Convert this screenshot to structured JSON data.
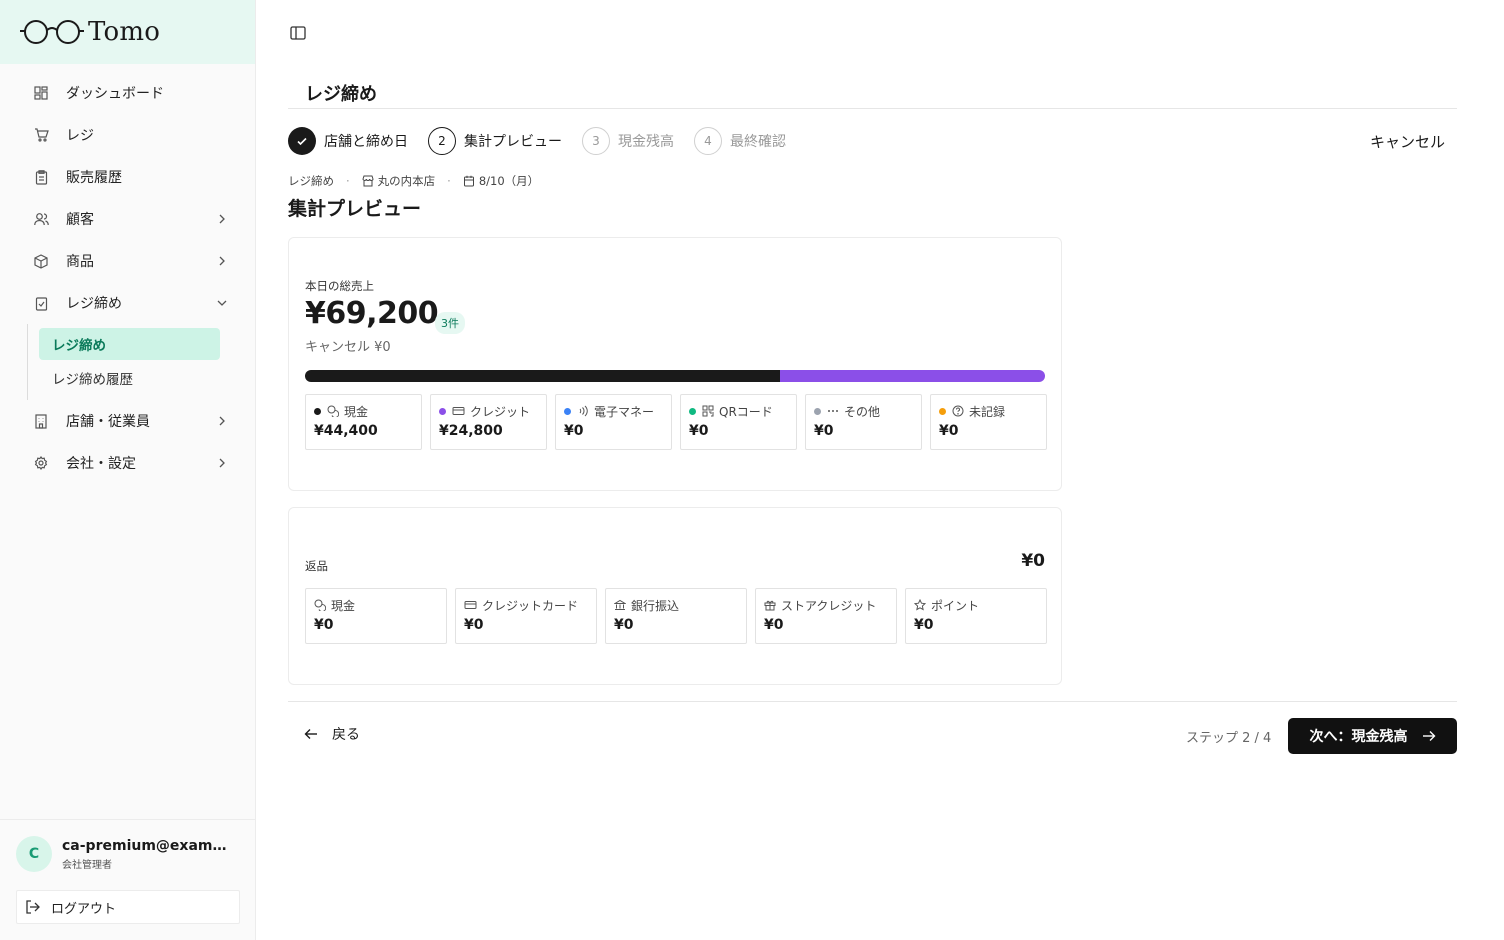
{
  "app": {
    "brand": "Tomo"
  },
  "sidebar": {
    "items": [
      {
        "label": "ダッシュボード",
        "icon": "dashboard-icon"
      },
      {
        "label": "レジ",
        "icon": "cart-icon"
      },
      {
        "label": "販売履歴",
        "icon": "receipt-icon"
      },
      {
        "label": "顧客",
        "icon": "users-icon"
      },
      {
        "label": "商品",
        "icon": "box-icon"
      },
      {
        "label": "レジ締め",
        "icon": "clipboard-check-icon"
      },
      {
        "label": "店舗・従業員",
        "icon": "building-icon"
      },
      {
        "label": "会社・設定",
        "icon": "gear-icon"
      }
    ],
    "sub_items": [
      {
        "label": "レジ締め",
        "active": true
      },
      {
        "label": "レジ締め履歴",
        "active": false
      }
    ]
  },
  "user": {
    "initial": "C",
    "email": "ca-premium@example.com",
    "role": "会社管理者",
    "logout_label": "ログアウト"
  },
  "header": {
    "title": "レジ締め"
  },
  "stepper": {
    "steps": [
      {
        "number": "1",
        "label": "店舗と締め日",
        "state": "done"
      },
      {
        "number": "2",
        "label": "集計プレビュー",
        "state": "current"
      },
      {
        "number": "3",
        "label": "現金残高",
        "state": "todo"
      },
      {
        "number": "4",
        "label": "最終確認",
        "state": "todo"
      }
    ],
    "cancel_label": "キャンセル"
  },
  "breadcrumb": {
    "root": "レジ締め",
    "store": "丸の内本店",
    "date": "8/10（月）"
  },
  "section_title": "集計プレビュー",
  "sales": {
    "label": "本日の総売上",
    "total": "¥69,200",
    "count": "3件",
    "cancel": "キャンセル ¥0",
    "payment_share": [
      {
        "method": "現金",
        "value": 44400,
        "color": "#1a1a1a"
      },
      {
        "method": "クレジット",
        "value": 24800,
        "color": "#8b4fe8"
      }
    ],
    "methods": [
      {
        "label": "現金",
        "value": "¥44,400",
        "dot": "#1a1a1a",
        "icon": "cash-icon"
      },
      {
        "label": "クレジット",
        "value": "¥24,800",
        "dot": "#8b4fe8",
        "icon": "credit-card-icon"
      },
      {
        "label": "電子マネー",
        "value": "¥0",
        "dot": "#3b82f6",
        "icon": "contactless-icon"
      },
      {
        "label": "QRコード",
        "value": "¥0",
        "dot": "#10b981",
        "icon": "qr-code-icon"
      },
      {
        "label": "その他",
        "value": "¥0",
        "dot": "#9ca3af",
        "icon": "more-icon"
      },
      {
        "label": "未記録",
        "value": "¥0",
        "dot": "#f59e0b",
        "icon": "help-circle-icon"
      }
    ]
  },
  "refunds": {
    "label": "返品",
    "total": "¥0",
    "methods": [
      {
        "label": "現金",
        "value": "¥0",
        "icon": "cash-icon"
      },
      {
        "label": "クレジットカード",
        "value": "¥0",
        "icon": "credit-card-icon"
      },
      {
        "label": "銀行振込",
        "value": "¥0",
        "icon": "bank-icon"
      },
      {
        "label": "ストアクレジット",
        "value": "¥0",
        "icon": "gift-icon"
      },
      {
        "label": "ポイント",
        "value": "¥0",
        "icon": "star-icon"
      }
    ]
  },
  "footer": {
    "back_label": "戻る",
    "step_count": "ステップ 2 / 4",
    "next_label": "次へ：現金残高"
  }
}
